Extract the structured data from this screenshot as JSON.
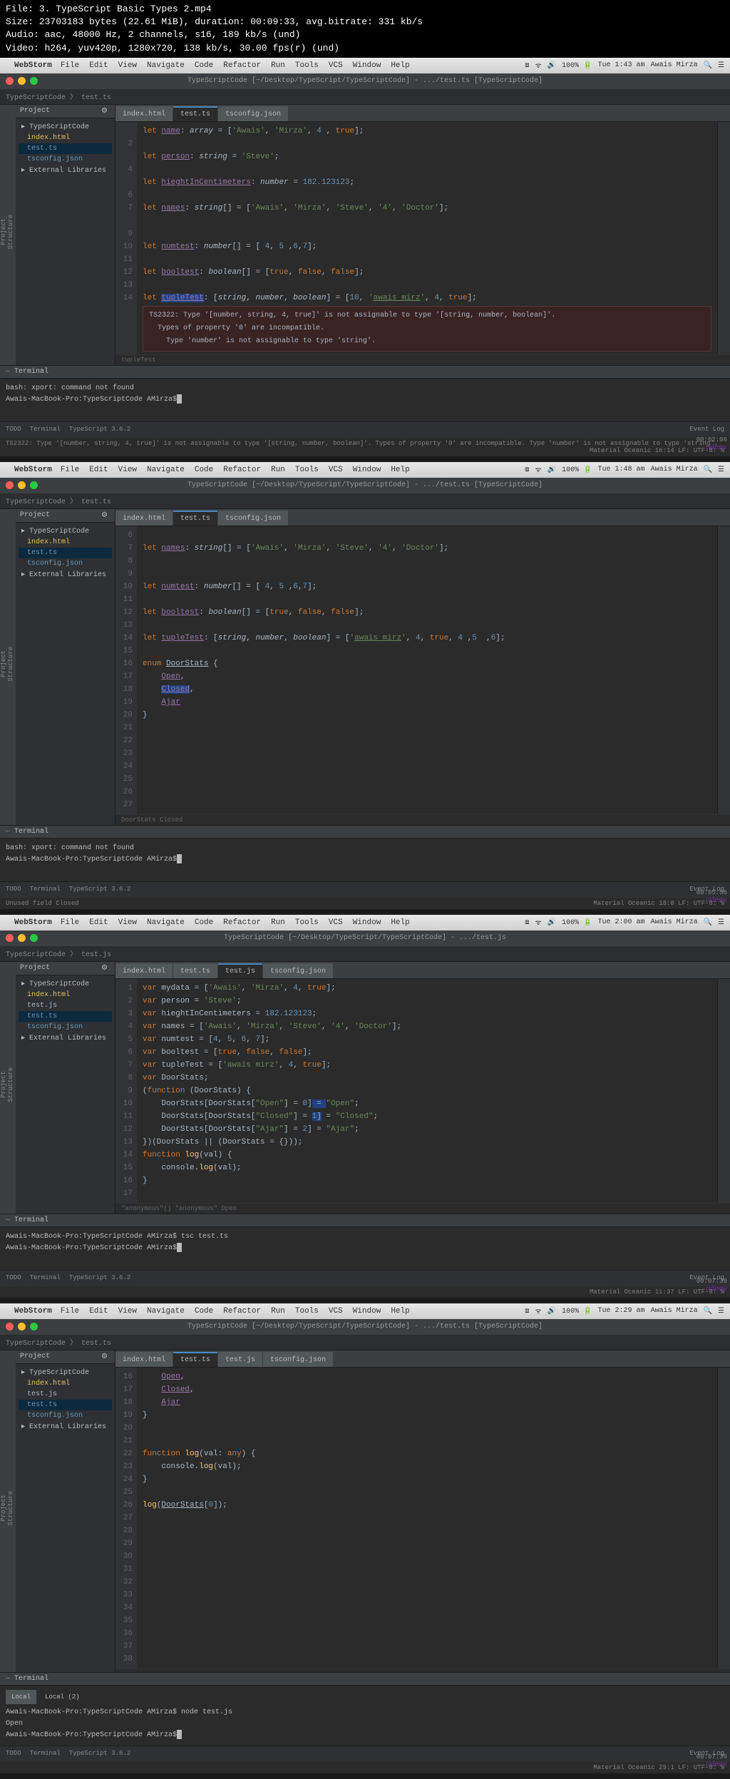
{
  "file_info": {
    "line1": "File: 3. TypeScript Basic Types 2.mp4",
    "line2": "Size: 23703183 bytes (22.61 MiB), duration: 00:09:33, avg.bitrate: 331 kb/s",
    "line3": "Audio: aac, 48000 Hz, 2 channels, s16, 189 kb/s (und)",
    "line4": "Video: h264, yuv420p, 1280x720, 138 kb/s, 30.00 fps(r) (und)"
  },
  "macmenu": {
    "app": "WebStorm",
    "items": [
      "File",
      "Edit",
      "View",
      "Navigate",
      "Code",
      "Refactor",
      "Run",
      "Tools",
      "VCS",
      "Window",
      "Help"
    ]
  },
  "screens": [
    {
      "time": "Tue 1:43 am",
      "battery": "100%",
      "user": "Awais Mirza",
      "title": "TypeScriptCode [~/Desktop/TypeScript/TypeScriptCode] - .../test.ts [TypeScriptCode]",
      "crumbs": "TypeScriptCode 〉 test.ts",
      "tree": [
        {
          "lvl": 0,
          "txt": "TypeScriptCode",
          "cls": "folder"
        },
        {
          "lvl": 1,
          "txt": "index.html",
          "cls": "file-html"
        },
        {
          "lvl": 1,
          "txt": "test.ts",
          "cls": "file-ts",
          "sel": true
        },
        {
          "lvl": 1,
          "txt": "tsconfig.json",
          "cls": "file-json"
        },
        {
          "lvl": 0,
          "txt": "External Libraries",
          "cls": "folder"
        }
      ],
      "editor_tabs": [
        {
          "label": "index.html"
        },
        {
          "label": "test.ts",
          "active": true
        },
        {
          "label": "tsconfig.json"
        }
      ],
      "gutter": [
        "",
        "2",
        "",
        "4",
        "",
        "6",
        "7",
        "",
        "9",
        "10",
        "11",
        "12",
        "13",
        "14"
      ],
      "code_html": "<span class='kw'>let</span> <span class='var'>name</span>: <span class='type'>array</span> = [<span class='str'>'Awais'</span>, <span class='str'>'Mirza'</span>, <span class='num'>4</span> , <span class='bool'>true</span>];\n\n<span class='kw'>let</span> <span class='var'>person</span>: <span class='type'>string</span> = <span class='str'>'Steve'</span>;\n\n<span class='kw'>let</span> <span class='var'>hieghtInCentimeters</span>: <span class='type'>number</span> = <span class='num'>182.123123</span>;\n\n<span class='kw'>let</span> <span class='var'>names</span>: <span class='type'>string</span>[] = [<span class='str'>'Awais'</span>, <span class='str'>'Mirza'</span>, <span class='str'>'Steve'</span>, <span class='str'>'4'</span>, <span class='str'>'Doctor'</span>];\n\n\n<span class='kw'>let</span> <span class='var'>numtest</span>: <span class='type'>number</span>[] = [ <span class='num'>4</span>, <span class='num'>5</span> ,<span class='num'>6</span>,<span class='num'>7</span>];\n\n<span class='kw'>let</span> <span class='var'>booltest</span>: <span class='type'>boolean</span>[] = [<span class='bool'>true</span>, <span class='bool'>false</span>, <span class='bool'>false</span>];\n\n<span class='kw'>let</span> <span class='var' style='background:#214283'>tupleTest</span>: [<span class='type'>string</span>, <span class='type'>number</span>, <span class='type'>boolean</span>] = [<span class='num'>10</span>, <span class='str'>'<u>awais mirz</u>'</span>, <span class='num'>4</span>, <span class='bool'>true</span>];",
      "error_hint": "TS2322: Type '[number, string, 4, true]' is not assignable to type '[string, number, boolean]'.\n  Types of property '0' are incompatible.\n    Type 'number' is not assignable to type 'string'.",
      "breadcrumb_bottom": "tupleTest",
      "terminal": [
        "bash: xport: command not found",
        "Awais-MacBook-Pro:TypeScriptCode AMirza$"
      ],
      "status_left": [
        "TODO",
        "Terminal",
        "TypeScript 3.6.2"
      ],
      "status_right": [
        "Event Log"
      ],
      "msgbar": "TS2322: Type '[number, string, 4, true]' is not assignable to type '[string, number, boolean]'. Types of property '0' are incompatible. Type 'number' is not assignable to type 'string'.",
      "msgbar_right": "Material Oceanic  16:14  LF:  UTF-8:  %",
      "timestamp": "00:02:06"
    },
    {
      "time": "Tue 1:48 am",
      "battery": "100%",
      "user": "Awais Mirza",
      "title": "TypeScriptCode [~/Desktop/TypeScript/TypeScriptCode] - .../test.ts [TypeScriptCode]",
      "crumbs": "TypeScriptCode 〉 test.ts",
      "tree": [
        {
          "lvl": 0,
          "txt": "TypeScriptCode",
          "cls": "folder"
        },
        {
          "lvl": 1,
          "txt": "index.html",
          "cls": "file-html"
        },
        {
          "lvl": 1,
          "txt": "test.ts",
          "cls": "file-ts",
          "sel": true
        },
        {
          "lvl": 1,
          "txt": "tsconfig.json",
          "cls": "file-json"
        },
        {
          "lvl": 0,
          "txt": "External Libraries",
          "cls": "folder"
        }
      ],
      "editor_tabs": [
        {
          "label": "index.html"
        },
        {
          "label": "test.ts",
          "active": true
        },
        {
          "label": "tsconfig.json"
        }
      ],
      "gutter": [
        "6",
        "7",
        "8",
        "9",
        "10",
        "11",
        "12",
        "13",
        "14",
        "15",
        "16",
        "17",
        "18",
        "19",
        "20",
        "21",
        "22",
        "23",
        "24",
        "25",
        "26",
        "27"
      ],
      "code_html": "\n<span class='kw'>let</span> <span class='var'>names</span>: <span class='type'>string</span>[] = [<span class='str'>'Awais'</span>, <span class='str'>'Mirza'</span>, <span class='str'>'Steve'</span>, <span class='str'>'4'</span>, <span class='str'>'Doctor'</span>];\n\n\n<span class='kw'>let</span> <span class='var'>numtest</span>: <span class='type'>number</span>[] = [ <span class='num'>4</span>, <span class='num'>5</span> ,<span class='num'>6</span>,<span class='num'>7</span>];\n\n<span class='kw'>let</span> <span class='var'>booltest</span>: <span class='type'>boolean</span>[] = [<span class='bool'>true</span>, <span class='bool'>false</span>, <span class='bool'>false</span>];\n\n<span class='kw'>let</span> <span class='var'>tupleTest</span>: [<span class='type'>string</span>, <span class='type'>number</span>, <span class='type'>boolean</span>] = [<span class='str'>'<u>awais mirz</u>'</span>, <span class='num'>4</span>, <span class='bool'>true</span>, <span class='num'>4</span> ,<span class='num'>5</span>  ,<span class='num'>6</span>];\n\n<span class='kw'>enum</span> <span class='enum'>DoorStats</span> {\n    <span class='var'>Open</span>,\n    <span class='var' style='background:#214283'>Closed</span>,\n    <span class='var'>Ajar</span>\n}\n\n\n\n\n\n\n",
      "breadcrumb_bottom": "DoorStats   Closed",
      "terminal": [
        "bash: xport: command not found",
        "Awais-MacBook-Pro:TypeScriptCode AMirza$"
      ],
      "status_left": [
        "TODO",
        "Terminal",
        "TypeScript 3.6.2"
      ],
      "status_right": [
        "Event Log"
      ],
      "msgbar": "Unused field Closed",
      "msgbar_right": "Material Oceanic  18:8  LF:  UTF-8:  %",
      "timestamp": "00:05:56"
    },
    {
      "time": "Tue 2:00 am",
      "battery": "100%",
      "user": "Awais Mirza",
      "title": "TypeScriptCode [~/Desktop/TypeScript/TypeScriptCode] - .../test.js",
      "crumbs": "TypeScriptCode 〉 test.js",
      "tree": [
        {
          "lvl": 0,
          "txt": "TypeScriptCode",
          "cls": "folder"
        },
        {
          "lvl": 1,
          "txt": "index.html",
          "cls": "file-html"
        },
        {
          "lvl": 1,
          "txt": "test.js",
          "cls": "file-js"
        },
        {
          "lvl": 1,
          "txt": "test.ts",
          "cls": "file-ts",
          "sel": true
        },
        {
          "lvl": 1,
          "txt": "tsconfig.json",
          "cls": "file-json"
        },
        {
          "lvl": 0,
          "txt": "External Libraries",
          "cls": "folder"
        }
      ],
      "editor_tabs": [
        {
          "label": "index.html"
        },
        {
          "label": "test.ts"
        },
        {
          "label": "test.js",
          "active": true
        },
        {
          "label": "tsconfig.json"
        }
      ],
      "gutter": [
        "1",
        "2",
        "3",
        "4",
        "5",
        "6",
        "7",
        "8",
        "9",
        "10",
        "11",
        "12",
        "13",
        "14",
        "15",
        "16",
        "17"
      ],
      "code_html": "<span class='kw'>var</span> mydata = [<span class='str'>'Awais'</span>, <span class='str'>'Mirza'</span>, <span class='num'>4</span>, <span class='bool'>true</span>];\n<span class='kw'>var</span> person = <span class='str'>'Steve'</span>;\n<span class='kw'>var</span> hieghtInCentimeters = <span class='num'>182.123123</span>;\n<span class='kw'>var</span> names = [<span class='str'>'Awais'</span>, <span class='str'>'Mirza'</span>, <span class='str'>'Steve'</span>, <span class='str'>'4'</span>, <span class='str'>'Doctor'</span>];\n<span class='kw'>var</span> numtest = [<span class='num'>4</span>, <span class='num'>5</span>, <span class='num'>6</span>, <span class='num'>7</span>];\n<span class='kw'>var</span> booltest = [<span class='bool'>true</span>, <span class='bool'>false</span>, <span class='bool'>false</span>];\n<span class='kw'>var</span> tupleTest = [<span class='str'>'awais mirz'</span>, <span class='num'>4</span>, <span class='bool'>true</span>];\n<span class='kw'>var</span> DoorStats;\n(<span class='kw'>function</span> (<span class='varNu'>DoorStats</span>) {\n    DoorStats[DoorStats[<span class='str'>\"Open\"</span>] = <span class='num'>0</span>]<span style='background:#214283'> = </span><span class='str'>\"Open\"</span>;\n    DoorStats[DoorStats[<span class='str'>\"Closed\"</span>] = <span style='background:#214283'><span class='num'>1</span>]</span> = <span class='str'>\"Closed\"</span>;\n    DoorStats[DoorStats[<span class='str'>\"Ajar\"</span>] = <span class='num'>2</span>] = <span class='str'>\"Ajar\"</span>;\n})(DoorStats || (DoorStats = {}));\n<span class='kw'>function</span> <span class='func'>log</span>(<span class='varNu'>val</span>) {\n    console.<span class='func'>log</span>(val);\n}\n",
      "breadcrumb_bottom": "\"anonymous\"()   \"anonymous\"   Open",
      "terminal": [
        "Awais-MacBook-Pro:TypeScriptCode AMirza$ tsc test.ts",
        "Awais-MacBook-Pro:TypeScriptCode AMirza$"
      ],
      "status_left": [
        "TODO",
        "Terminal",
        "TypeScript 3.6.2"
      ],
      "status_right": [
        "Event Log"
      ],
      "msgbar": "",
      "msgbar_right": "Material Oceanic  11:37  LF:  UTF-8:  %",
      "timestamp": "00:07:39"
    },
    {
      "time": "Tue 2:29 am",
      "battery": "100%",
      "user": "Awais Mirza",
      "title": "TypeScriptCode [~/Desktop/TypeScript/TypeScriptCode] - .../test.ts [TypeScriptCode]",
      "crumbs": "TypeScriptCode 〉 test.ts",
      "tree": [
        {
          "lvl": 0,
          "txt": "TypeScriptCode",
          "cls": "folder"
        },
        {
          "lvl": 1,
          "txt": "index.html",
          "cls": "file-html"
        },
        {
          "lvl": 1,
          "txt": "test.js",
          "cls": "file-js"
        },
        {
          "lvl": 1,
          "txt": "test.ts",
          "cls": "file-ts",
          "sel": true
        },
        {
          "lvl": 1,
          "txt": "tsconfig.json",
          "cls": "file-json"
        },
        {
          "lvl": 0,
          "txt": "External Libraries",
          "cls": "folder"
        }
      ],
      "editor_tabs": [
        {
          "label": "index.html"
        },
        {
          "label": "test.ts",
          "active": true
        },
        {
          "label": "test.js"
        },
        {
          "label": "tsconfig.json"
        }
      ],
      "gutter": [
        "16",
        "17",
        "18",
        "19",
        "20",
        "21",
        "22",
        "23",
        "24",
        "25",
        "26",
        "27",
        "28",
        "29",
        "30",
        "31",
        "32",
        "33",
        "34",
        "35",
        "36",
        "37",
        "38"
      ],
      "code_html": "    <span class='var'>Open</span>,\n    <span class='var'>Closed</span>,\n    <span class='var'>Ajar</span>\n}\n\n\n<span class='kw'>function</span> <span class='func'>log</span>(<span class='varNu'>val</span>: <span class='kw'>any</span>) {\n    console.<span class='func'>log</span>(val);\n}\n\n<span class='func'>log</span>(<span class='enum'>DoorStats</span>[<span class='num'>0</span>]);\n\n\n\n\n\n\n\n\n\n\n\n",
      "breadcrumb_bottom": "",
      "terminal_tabs": [
        "Local",
        "Local (2)"
      ],
      "terminal": [
        "Awais-MacBook-Pro:TypeScriptCode AMirza$ node test.js",
        "Open",
        "Awais-MacBook-Pro:TypeScriptCode AMirza$"
      ],
      "status_left": [
        "TODO",
        "Terminal",
        "TypeScript 3.6.2"
      ],
      "status_right": [
        "Event Log"
      ],
      "msgbar": "",
      "msgbar_right": "Material Oceanic  29:1  LF:  UTF-8:  %",
      "timestamp": "00:07:39"
    }
  ],
  "project_label": "Project",
  "terminal_label": "Terminal"
}
